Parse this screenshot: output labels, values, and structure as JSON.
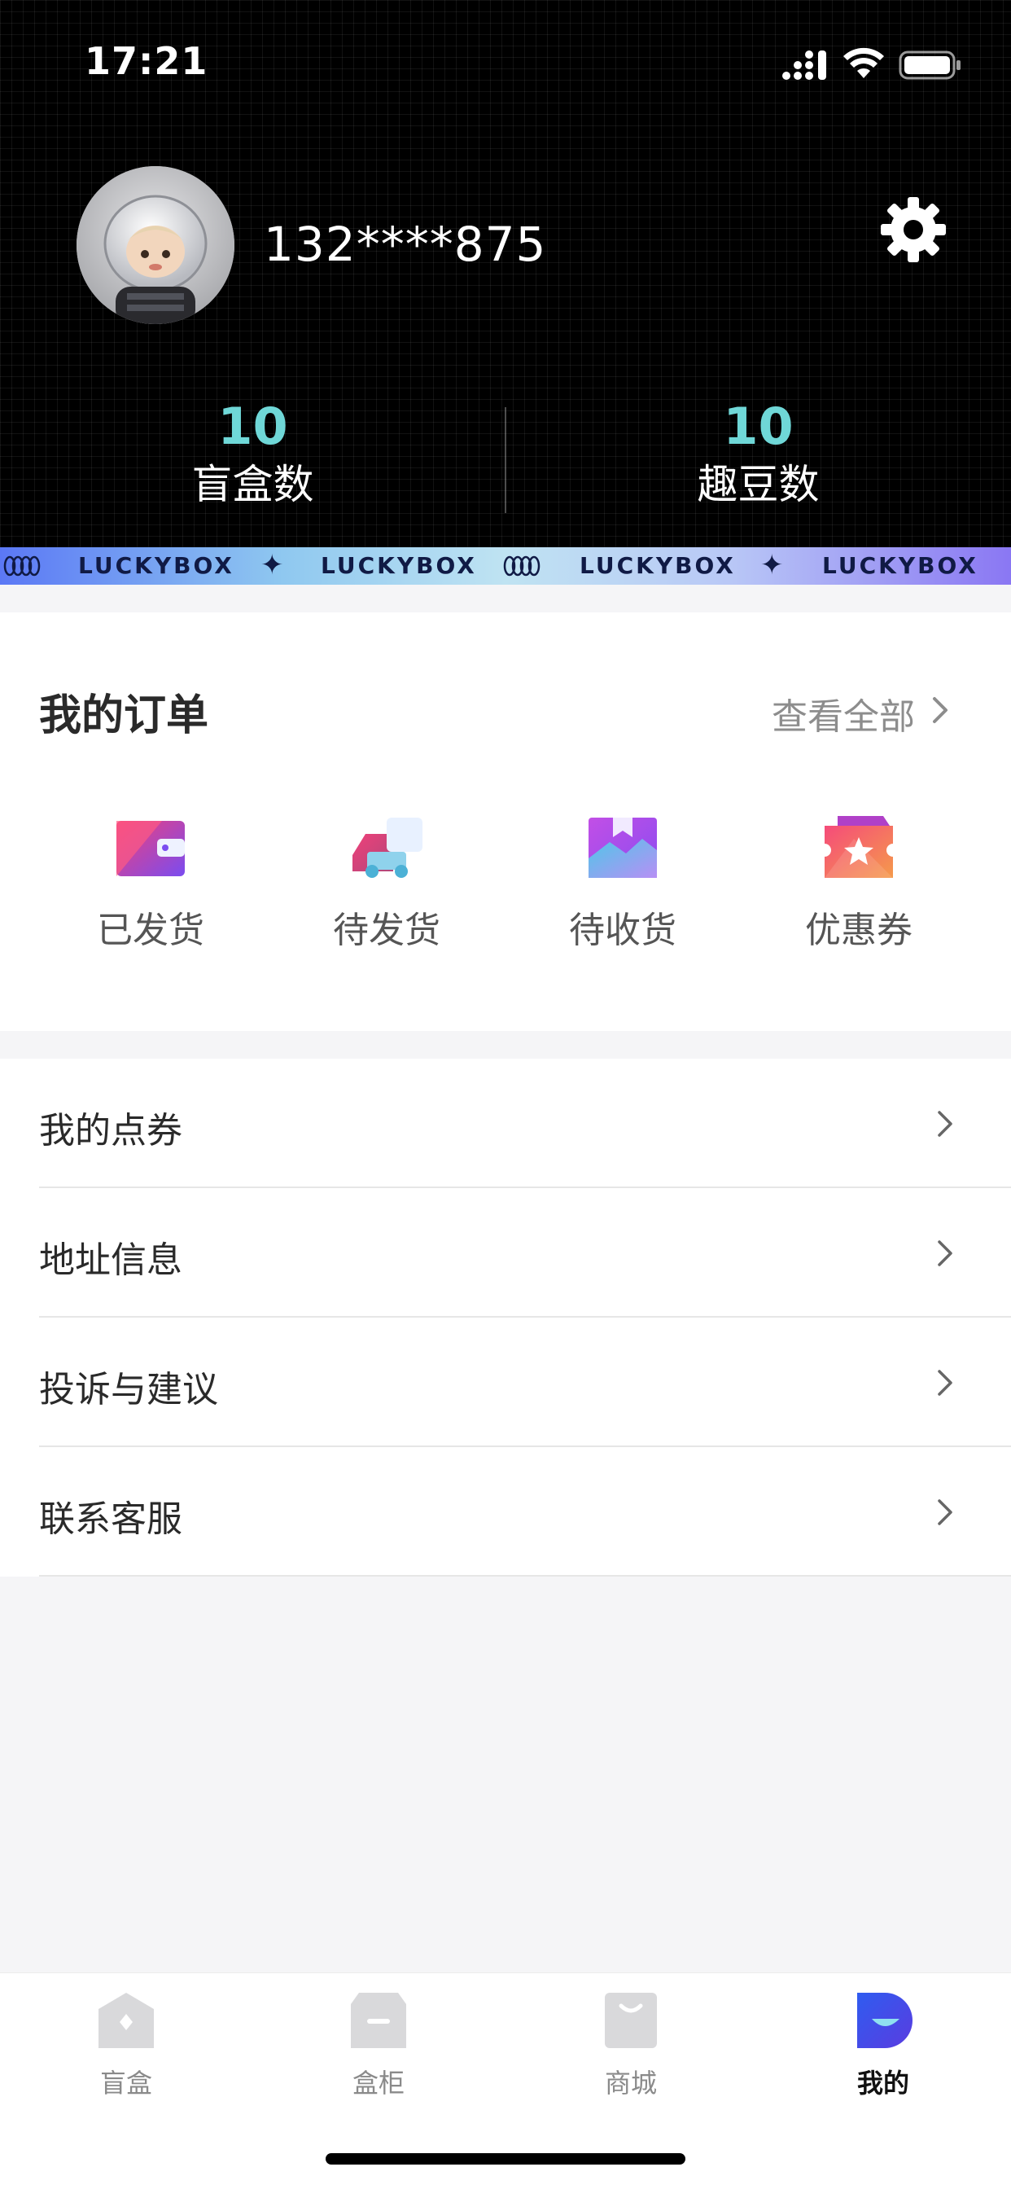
{
  "status_bar": {
    "time": "17:21"
  },
  "profile": {
    "username": "132****875"
  },
  "stats": [
    {
      "value": "10",
      "label": "盲盒数"
    },
    {
      "value": "10",
      "label": "趣豆数"
    }
  ],
  "banner": {
    "items": [
      "LUCKYBOX",
      "LUCKYBOX",
      "LUCKYBOX",
      "LUCKYBOX"
    ]
  },
  "orders": {
    "title": "我的订单",
    "view_all": "查看全部",
    "items": [
      {
        "label": "已发货",
        "icon": "wallet-icon"
      },
      {
        "label": "待发货",
        "icon": "delivery-truck-icon"
      },
      {
        "label": "待收货",
        "icon": "package-box-icon"
      },
      {
        "label": "优惠券",
        "icon": "coupon-icon"
      }
    ]
  },
  "menu": {
    "items": [
      {
        "label": "我的点券"
      },
      {
        "label": "地址信息"
      },
      {
        "label": "投诉与建议"
      },
      {
        "label": "联系客服"
      }
    ]
  },
  "tabbar": {
    "items": [
      {
        "label": "盲盒",
        "icon": "blind-box-icon",
        "active": false
      },
      {
        "label": "盒柜",
        "icon": "box-cabinet-icon",
        "active": false
      },
      {
        "label": "商城",
        "icon": "shopping-bag-icon",
        "active": false
      },
      {
        "label": "我的",
        "icon": "profile-icon",
        "active": true
      }
    ]
  },
  "colors": {
    "accent_stat": "#6fd7d7",
    "header_bg": "#000000",
    "banner_start": "#5b78f5",
    "banner_end": "#8a77f3"
  }
}
